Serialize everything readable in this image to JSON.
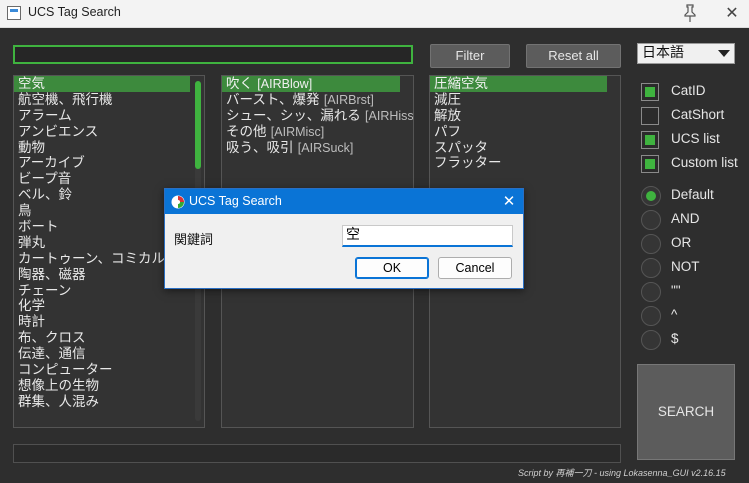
{
  "window": {
    "title": "UCS Tag Search",
    "pin_icon": "pin-icon",
    "close_icon": "close-icon"
  },
  "toolbar": {
    "filter_value": "",
    "filter_label": "Filter",
    "reset_label": "Reset all",
    "language": "日本語"
  },
  "lists": {
    "categories": [
      "空気",
      "航空機、飛行機",
      "アラーム",
      "アンビエンス",
      "動物",
      "アーカイブ",
      "ビープ音",
      "ベル、鈴",
      "鳥",
      "ボート",
      "弾丸",
      "カートゥーン、コミカル",
      "陶器、磁器",
      "チェーン",
      "化学",
      "時計",
      "布、クロス",
      "伝達、通信",
      "コンピューター",
      "想像上の生物",
      "群集、人混み"
    ],
    "subcategories": [
      {
        "name": "吹く",
        "tag": "[AIRBlow]"
      },
      {
        "name": "バースト、爆発",
        "tag": "[AIRBrst]"
      },
      {
        "name": "シュー、シッ、漏れる",
        "tag": "[AIRHiss]"
      },
      {
        "name": "その他",
        "tag": "[AIRMisc]"
      },
      {
        "name": "吸う、吸引",
        "tag": "[AIRSuck]"
      }
    ],
    "keywords": [
      "圧縮空気",
      "減圧",
      "解放",
      "パフ",
      "スパッタ",
      "フラッター"
    ]
  },
  "options": {
    "checkboxes": [
      {
        "label": "CatID",
        "checked": true
      },
      {
        "label": "CatShort",
        "checked": false
      },
      {
        "label": "UCS list",
        "checked": true
      },
      {
        "label": "Custom list",
        "checked": true
      }
    ],
    "radios": [
      {
        "label": "Default",
        "checked": true
      },
      {
        "label": "AND",
        "checked": false
      },
      {
        "label": "OR",
        "checked": false
      },
      {
        "label": "NOT",
        "checked": false
      },
      {
        "label": "\"\"",
        "checked": false
      },
      {
        "label": "^",
        "checked": false
      },
      {
        "label": "$",
        "checked": false
      }
    ]
  },
  "search_label": "SEARCH",
  "status_value": "",
  "credit": "Script by 再補一刀 - using Lokasenna_GUI v2.16.15",
  "dialog": {
    "title": "UCS Tag Search",
    "label": "関鍵詞",
    "value": "空",
    "ok_label": "OK",
    "cancel_label": "Cancel"
  },
  "colors": {
    "accent": "#3fb33f",
    "background": "#2e2e2e",
    "dialog_title": "#0a74d6"
  }
}
